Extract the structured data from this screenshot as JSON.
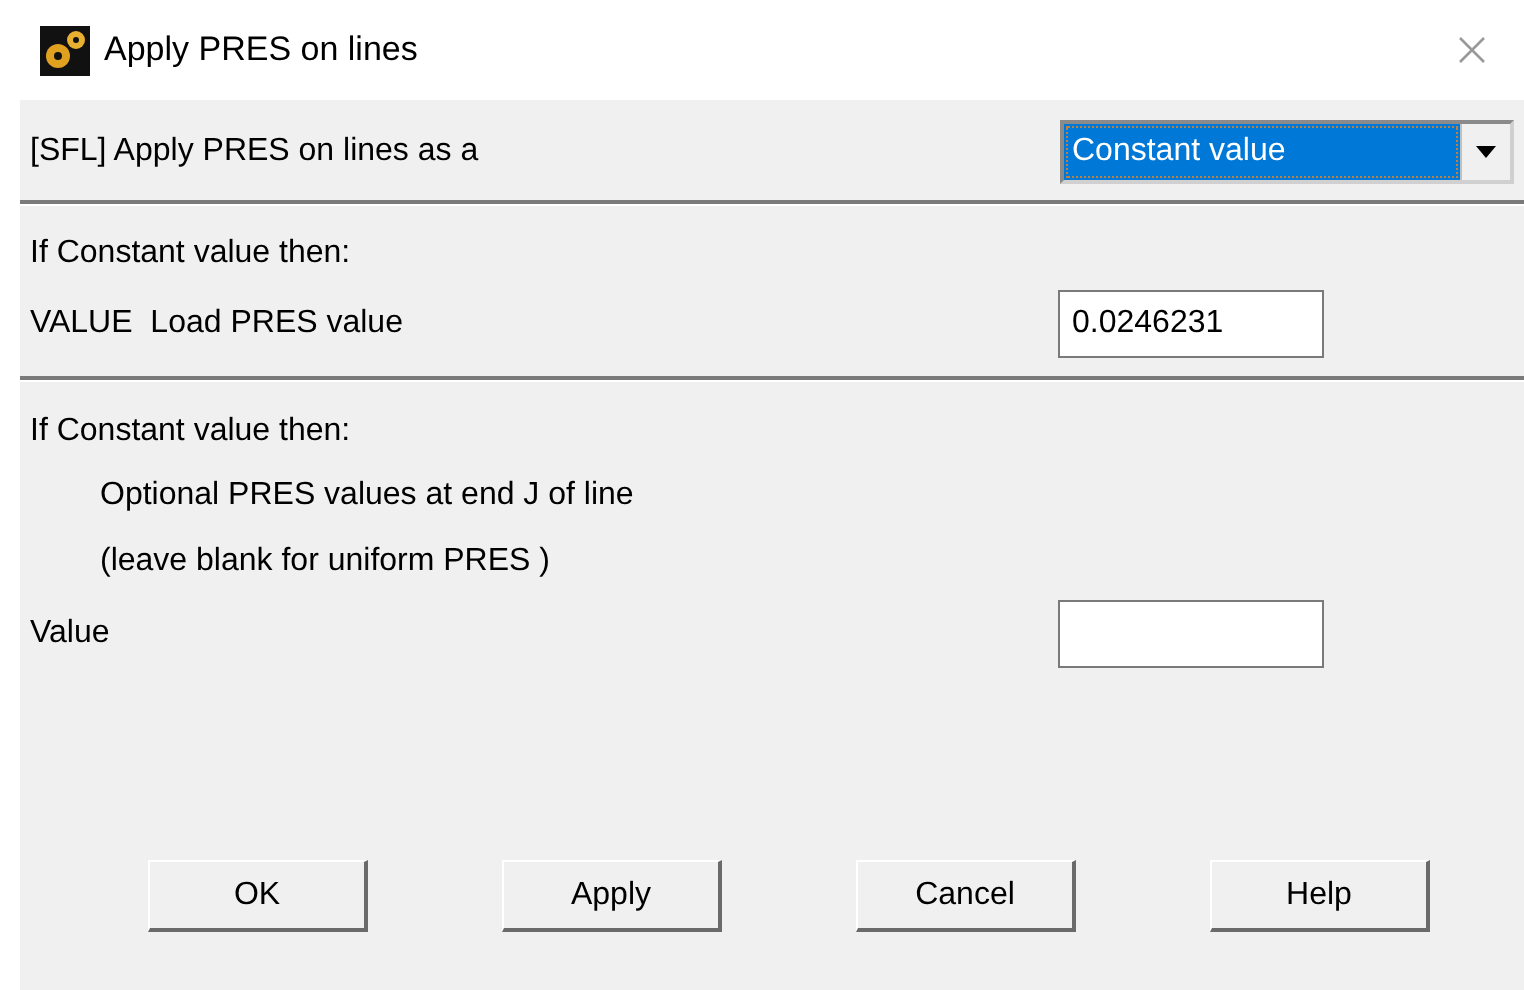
{
  "window": {
    "title": "Apply PRES on lines"
  },
  "sections": [
    {
      "rows": [
        {
          "kind": "dropdown",
          "label": "[SFL] Apply PRES on lines as a",
          "value": "Constant value"
        }
      ]
    },
    {
      "rows": [
        {
          "kind": "text",
          "label": "If Constant value then:"
        },
        {
          "kind": "field",
          "label": "VALUE  Load PRES value",
          "value": "0.0246231"
        }
      ]
    },
    {
      "rows": [
        {
          "kind": "text",
          "label": "If Constant value then:"
        },
        {
          "kind": "note",
          "label": "Optional PRES values at end J of line"
        },
        {
          "kind": "note",
          "label": "(leave blank for uniform PRES )"
        },
        {
          "kind": "field",
          "label": "Value"
        }
      ]
    }
  ],
  "buttons": [
    "OK",
    "Apply",
    "Cancel",
    "Help"
  ]
}
